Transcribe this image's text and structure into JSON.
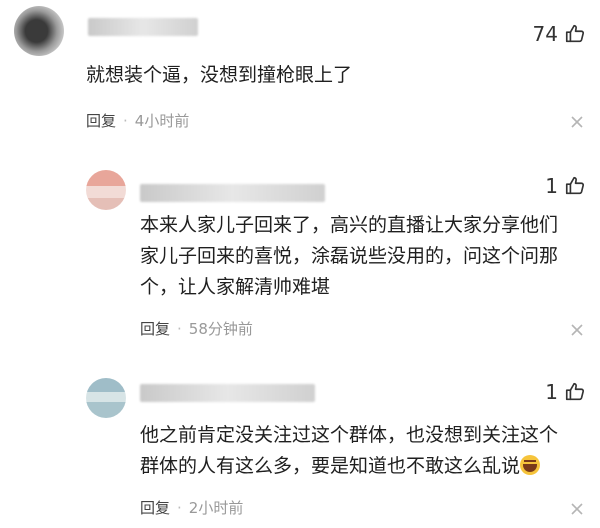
{
  "comments": [
    {
      "likes": "74",
      "text_lines": [
        "就想装个逼，没想到撞枪眼上了"
      ],
      "reply_label": "回复",
      "separator": "·",
      "time": "4小时前"
    },
    {
      "likes": "1",
      "text_lines": [
        "本来人家儿子回来了，高兴的直播让大家分享他们",
        "家儿子回来的喜悦，涂磊说些没用的，问这个问那",
        "个，让人家解清帅难堪"
      ],
      "reply_label": "回复",
      "separator": "·",
      "time": "58分钟前"
    },
    {
      "likes": "1",
      "text_lines": [
        "他之前肯定没关注过这个群体，也没想到关注这个",
        "群体的人有这么多，要是知道也不敢这么乱说"
      ],
      "emoji": "laugh-cry-emoji",
      "reply_label": "回复",
      "separator": "·",
      "time": "2小时前"
    }
  ],
  "icons": {
    "like": "thumbs-up-icon",
    "dismiss": "close-icon"
  },
  "colors": {
    "text": "#1f1f1f",
    "meta": "#999999",
    "reply": "#444444",
    "emoji": "#f6c43b"
  }
}
